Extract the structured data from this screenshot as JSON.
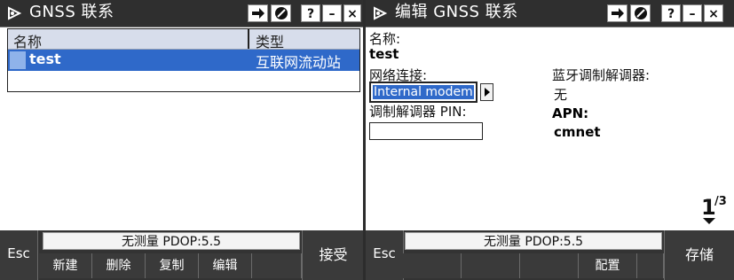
{
  "left": {
    "title": "GNSS 联系",
    "titlebar_buttons": {
      "help": "?",
      "minimize": "–",
      "close": "×"
    },
    "list": {
      "headers": {
        "name": "名称",
        "type": "类型"
      },
      "rows": [
        {
          "name": "test",
          "type": "互联网流动站"
        }
      ]
    },
    "status": "无测量  PDOP:5.5",
    "esc": "Esc",
    "softkeys": {
      "new": "新建",
      "delete": "删除",
      "copy": "复制",
      "edit": "编辑"
    },
    "accept": "接受"
  },
  "right": {
    "title": "编辑 GNSS 联系",
    "titlebar_buttons": {
      "help": "?",
      "minimize": "–",
      "close": "×"
    },
    "form": {
      "name_label": "名称:",
      "name_value": "test",
      "network_label": "网络连接:",
      "network_value": "Internal modem",
      "bluetooth_label": "蓝牙调制解调器:",
      "bluetooth_value": "无",
      "pin_label": "调制解调器 PIN:",
      "pin_value": "",
      "apn_label": "APN:",
      "apn_value": "cmnet"
    },
    "pager": {
      "current": "1",
      "total": "/3"
    },
    "status": "无测量  PDOP:5.5",
    "esc": "Esc",
    "softkeys": {
      "config": "配置"
    },
    "store": "存储"
  },
  "colors": {
    "titlebar": "#2f2f2f",
    "selection": "#2f69c9",
    "header": "#d7ddeb",
    "softkey_bar": "#333333"
  },
  "icons": [
    "app-satellite-icon",
    "forward-icon",
    "stop-icon",
    "dropdown-arrow-icon",
    "page-down-arrow-icon"
  ]
}
